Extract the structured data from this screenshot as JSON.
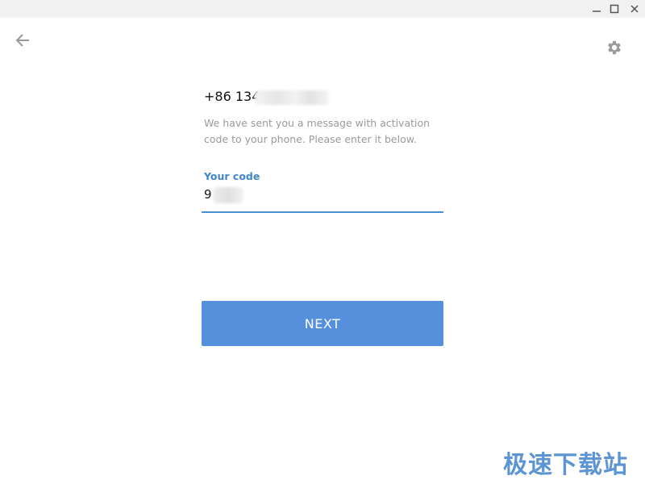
{
  "window": {
    "minimize_icon": "minimize-icon",
    "maximize_icon": "maximize-icon",
    "close_icon": "close-icon"
  },
  "header": {
    "back_icon": "arrow-left-icon",
    "settings_icon": "gear-icon"
  },
  "main": {
    "phone_number": "+86 134",
    "hint": "We have sent you a message with activation code to your phone. Please enter it below.",
    "code_label": "Your code",
    "code_value": "9",
    "next_label": "NEXT"
  },
  "watermark": {
    "text": "极速下载站"
  },
  "colors": {
    "accent": "#5690dd",
    "label_blue": "#3f86c9",
    "hint_gray": "#9a9a9a",
    "titlebar": "#f1f1f1"
  }
}
